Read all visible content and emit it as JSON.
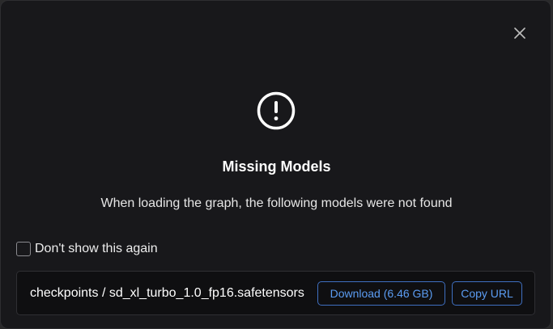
{
  "dialog": {
    "title": "Missing Models",
    "message": "When loading the graph, the following models were not found",
    "warning_icon": "exclamation-circle-icon",
    "close_icon": "close-icon"
  },
  "dont_show": {
    "label": "Don't show this again",
    "checked": false
  },
  "models": [
    {
      "name": "checkpoints / sd_xl_turbo_1.0_fp16.safetensors",
      "download_label": "Download (6.46 GB)",
      "copy_label": "Copy URL"
    }
  ],
  "colors": {
    "dialog_bg": "#18181b",
    "row_bg": "#0f0f11",
    "accent": "#5b9cf2"
  }
}
